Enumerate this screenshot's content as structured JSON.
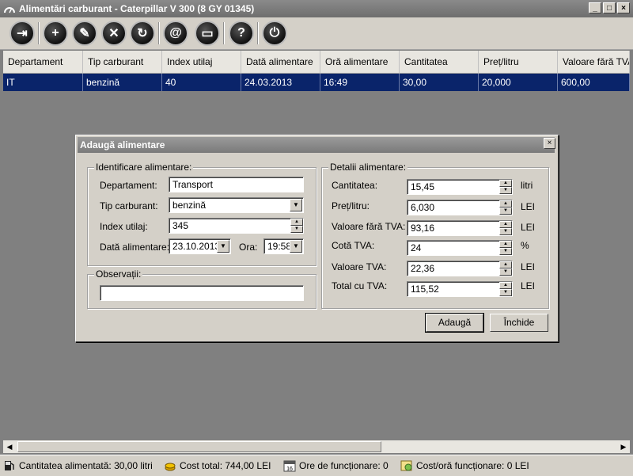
{
  "window": {
    "title": "Alimentări carburant - Caterpillar  V 300 (8 GY 01345)",
    "minimize": "_",
    "maximize": "□",
    "close": "×"
  },
  "toolbar": {
    "buttons": [
      {
        "icon": "exit-icon",
        "glyph": "⇥"
      },
      {
        "icon": "add-icon",
        "glyph": "+"
      },
      {
        "icon": "edit-icon",
        "glyph": "✎"
      },
      {
        "icon": "delete-icon",
        "glyph": "✕"
      },
      {
        "icon": "refresh-icon",
        "glyph": "↻"
      },
      {
        "icon": "email-icon",
        "glyph": "@"
      },
      {
        "icon": "print-icon",
        "glyph": "▭"
      },
      {
        "icon": "help-icon",
        "glyph": "?"
      },
      {
        "icon": "power-icon",
        "glyph": "⏻"
      }
    ]
  },
  "grid": {
    "columns": [
      "Departament",
      "Tip carburant",
      "Index utilaj",
      "Dată alimentare",
      "Oră alimentare",
      "Cantitatea",
      "Preț/litru",
      "Valoare fără TVA"
    ],
    "rows": [
      [
        "IT",
        "benzină",
        "40",
        "24.03.2013",
        "16:49",
        "30,00",
        "20,000",
        "600,00"
      ]
    ]
  },
  "dialog": {
    "title": "Adaugă alimentare",
    "close": "×",
    "identificare": {
      "legend": "Identificare alimentare:",
      "departament_label": "Departament:",
      "departament_value": "Transport",
      "tip_label": "Tip carburant:",
      "tip_value": "benzină",
      "index_label": "Index utilaj:",
      "index_value": "345",
      "data_label": "Dată alimentare:",
      "data_value": "23.10.2013",
      "ora_label": "Ora:",
      "ora_value": "19:58"
    },
    "observatii": {
      "legend": "Observații:",
      "value": ""
    },
    "detalii": {
      "legend": "Detalii alimentare:",
      "cantitatea_label": "Cantitatea:",
      "cantitatea_value": "15,45",
      "cantitatea_unit": "litri",
      "pret_label": "Preț/litru:",
      "pret_value": "6,030",
      "pret_unit": "LEI",
      "valoare_label": "Valoare fără TVA:",
      "valoare_value": "93,16",
      "valoare_unit": "LEI",
      "cota_label": "Cotă TVA:",
      "cota_value": "24",
      "cota_unit": "%",
      "tva_label": "Valoare TVA:",
      "tva_value": "22,36",
      "tva_unit": "LEI",
      "total_label": "Total cu TVA:",
      "total_value": "115,52",
      "total_unit": "LEI"
    },
    "add_button": "Adaugă",
    "close_button": "Închide"
  },
  "status": {
    "cantitatea": "Cantitatea alimentată: 30,00 litri",
    "cost_total": "Cost total: 744,00 LEI",
    "ore": "Ore de funcționare: 0",
    "cost_ora": "Cost/oră funcționare: 0 LEI"
  }
}
